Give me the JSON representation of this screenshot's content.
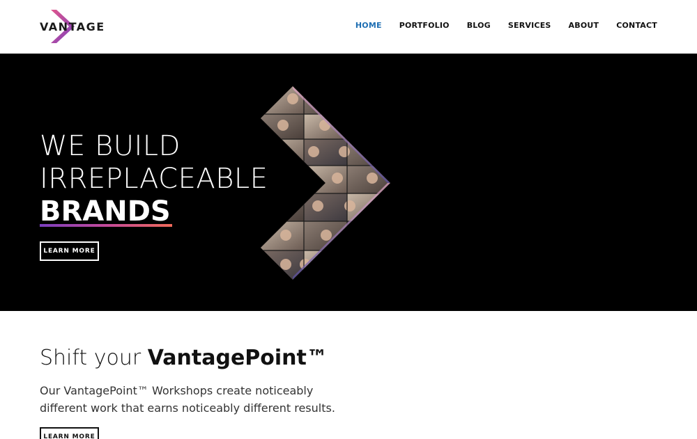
{
  "brand": {
    "logo_text": "VANTAGE",
    "accent_gradient": [
      "#7b3fbf",
      "#c44a9a",
      "#f06a5a"
    ]
  },
  "nav": {
    "items": [
      {
        "label": "HOME",
        "active": true
      },
      {
        "label": "PORTFOLIO",
        "active": false
      },
      {
        "label": "BLOG",
        "active": false
      },
      {
        "label": "SERVICES",
        "active": false
      },
      {
        "label": "ABOUT",
        "active": false
      },
      {
        "label": "CONTACT",
        "active": false
      }
    ],
    "active_color": "#1f6fb3"
  },
  "hero": {
    "line1": "WE BUILD",
    "line2": "IRREPLACEABLE",
    "line3": "BRANDS",
    "button_label": "LEARN MORE",
    "image": "video-call-collage-chevron"
  },
  "section": {
    "heading_light": "Shift your ",
    "heading_bold": "VantagePoint™",
    "body": "Our VantagePoint™ Workshops create noticeably different work that earns noticeably different results.",
    "button_label": "LEARN MORE"
  }
}
